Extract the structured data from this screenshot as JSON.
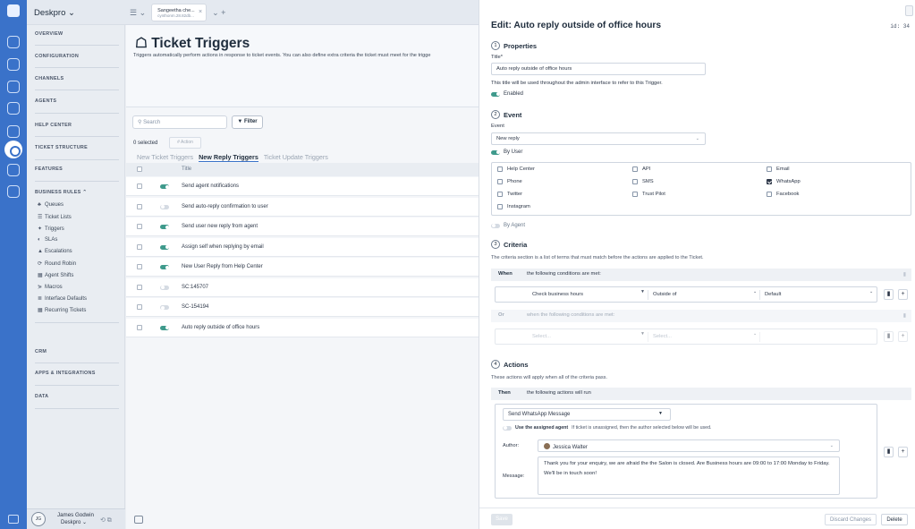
{
  "app": {
    "brand": "Deskpro ⌄"
  },
  "tab": {
    "title": "Sangeetha che...",
    "subtitle": "cynthonm.28.82db..."
  },
  "nav": {
    "overview": "OVERVIEW",
    "configuration": "CONFIGURATION",
    "channels": "CHANNELS",
    "agents": "AGENTS",
    "help_center": "HELP CENTER",
    "ticket_structure": "TICKET STRUCTURE",
    "features": "FEATURES",
    "business_rules": "BUSINESS RULES ⌃",
    "sub": [
      {
        "icon": "♣",
        "label": "Queues"
      },
      {
        "icon": "☰",
        "label": "Ticket Lists"
      },
      {
        "icon": "✦",
        "label": "Triggers"
      },
      {
        "icon": "◐",
        "label": "SLAs"
      },
      {
        "icon": "▲",
        "label": "Escalations"
      },
      {
        "icon": "⟳",
        "label": "Round Robin"
      },
      {
        "icon": "▦",
        "label": "Agent Shifts"
      },
      {
        "icon": "⋟",
        "label": "Macros"
      },
      {
        "icon": "≣",
        "label": "Interface Defaults"
      },
      {
        "icon": "▦",
        "label": "Recurring Tickets"
      }
    ],
    "crm": "CRM",
    "apps": "APPS & INTEGRATIONS",
    "data": "DATA"
  },
  "user": {
    "initials": "JG",
    "name": "James Godwin",
    "org": "Deskpro ⌄"
  },
  "page": {
    "title": "Ticket Triggers",
    "description": "Triggers automatically perform actions in response to ticket events. You can also define extra criteria the ticket must meet for the trigge",
    "search_placeholder": "Search",
    "filter": "Filter",
    "selected": "0 selected",
    "action": "Action",
    "tabs": [
      "New Ticket Triggers",
      "New Reply Triggers",
      "Ticket Update Triggers"
    ],
    "col_title": "Title",
    "rows": [
      {
        "title": "Send agent notifications",
        "on": true
      },
      {
        "title": "Send auto-reply confirmation to user",
        "on": false
      },
      {
        "title": "Send user new reply from agent",
        "on": true
      },
      {
        "title": "Assign self when replying by email",
        "on": true
      },
      {
        "title": "New User Reply from Help Center",
        "on": true
      },
      {
        "title": "SC:145707",
        "on": false
      },
      {
        "title": "SC-154194",
        "on": false
      },
      {
        "title": "Auto reply outside of office hours",
        "on": true
      }
    ]
  },
  "panel": {
    "title": "Edit: Auto reply outside of office hours",
    "id": "id: 34",
    "properties": {
      "num": "1",
      "heading": "Properties",
      "title_label": "Title*",
      "title_value": "Auto reply outside of office hours",
      "help": "This title will be used throughout the admin interface to refer to this Trigger.",
      "enabled": "Enabled"
    },
    "event": {
      "num": "2",
      "heading": "Event",
      "label": "Event",
      "value": "New reply",
      "by_user": "By User",
      "by_agent": "By Agent",
      "options": [
        {
          "label": "Help Center",
          "checked": false
        },
        {
          "label": "API",
          "checked": false
        },
        {
          "label": "Email",
          "checked": false
        },
        {
          "label": "Phone",
          "checked": false
        },
        {
          "label": "SMS",
          "checked": false
        },
        {
          "label": "WhatsApp",
          "checked": true
        },
        {
          "label": "Twitter",
          "checked": false
        },
        {
          "label": "Trust Pilot",
          "checked": false
        },
        {
          "label": "Facebook",
          "checked": false
        },
        {
          "label": "Instagram",
          "checked": false
        }
      ]
    },
    "criteria": {
      "num": "3",
      "heading": "Criteria",
      "desc": "The criteria section is a list of terms that must match before the actions are applied to the Ticket.",
      "when": "When",
      "when_text": "the following conditions are met:",
      "cond1": "Check business hours",
      "cond2": "Outside of",
      "cond3": "Default",
      "or": "Or",
      "or_text": "when the following conditions are met:",
      "ph1": "Select...",
      "ph2": "Select..."
    },
    "actions": {
      "num": "4",
      "heading": "Actions",
      "desc": "These actions will apply when all of the criteria pass.",
      "then": "Then",
      "then_text": "the following actions will run",
      "action": "Send WhatsApp Message",
      "use_assigned_bold": "Use the assigned agent",
      "use_assigned_rest": "If ticket is unassigned, then the author selected below will be used.",
      "author_label": "Author:",
      "author": "Jessica Walter",
      "message_label": "Message:",
      "message_p1": "Thank you for your enquiry, we are afraid the the Salon is closed. Are Business hours are 09:00 to 17:00 Monday to Friday.",
      "message_p2": "We'll be in touch soon!"
    },
    "save": "Save",
    "discard": "Discard Changes",
    "delete": "Delete"
  },
  "colors": {
    "rail": "#3a72c9",
    "toggle_on": "#3f9a8c"
  }
}
